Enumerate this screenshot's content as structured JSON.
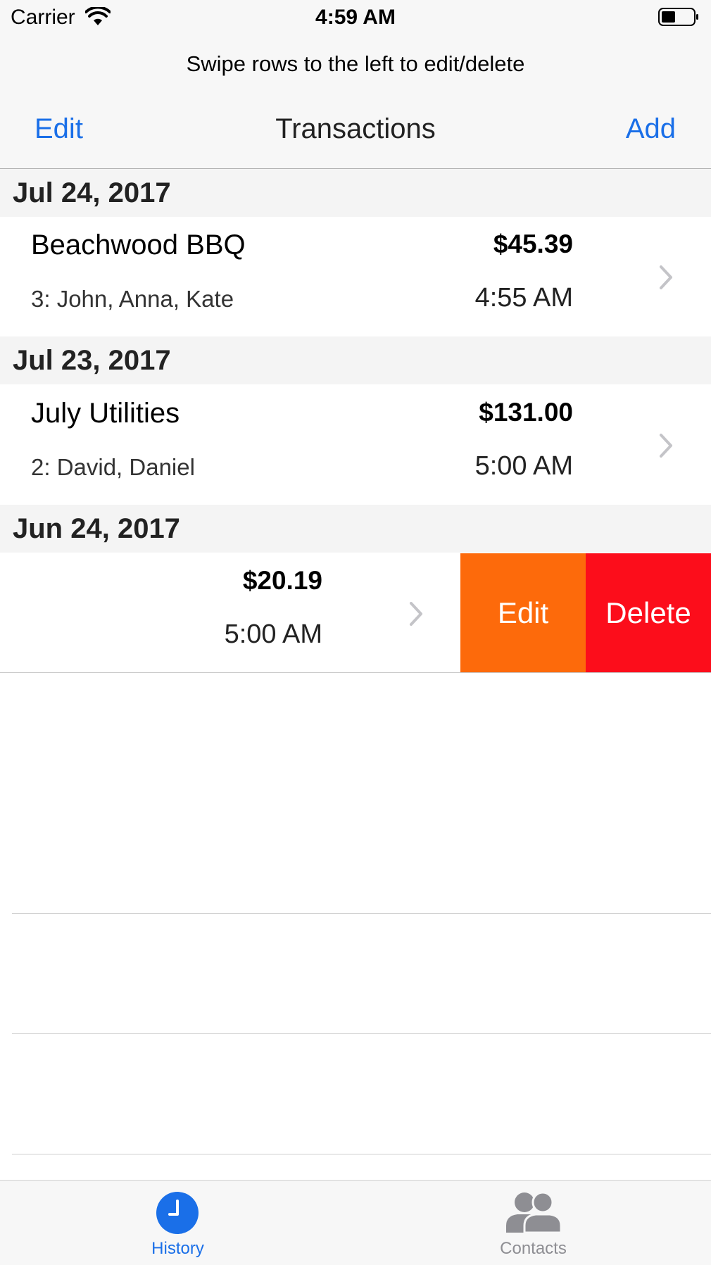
{
  "status_bar": {
    "carrier": "Carrier",
    "time": "4:59 AM"
  },
  "hint": "Swipe rows to the left to edit/delete",
  "nav": {
    "left": "Edit",
    "title": "Transactions",
    "right": "Add"
  },
  "sections": [
    {
      "date": "Jul 24, 2017",
      "rows": [
        {
          "name": "Beachwood BBQ",
          "people": "3: John, Anna, Kate",
          "amount": "$45.39",
          "time": "4:55 AM"
        }
      ]
    },
    {
      "date": "Jul 23, 2017",
      "rows": [
        {
          "name": "July Utilities",
          "people": "2: David, Daniel",
          "amount": "$131.00",
          "time": "5:00 AM"
        }
      ]
    },
    {
      "date": "Jun 24, 2017",
      "rows": [
        {
          "amount": "$20.19",
          "time": "5:00 AM"
        }
      ]
    }
  ],
  "swipe_actions": {
    "edit": "Edit",
    "delete": "Delete"
  },
  "tabs": [
    {
      "label": "History",
      "icon": "clock-icon",
      "selected": true
    },
    {
      "label": "Contacts",
      "icon": "contacts-icon",
      "selected": false
    }
  ],
  "colors": {
    "tint": "#1a6fe8",
    "edit_action": "#fd6a0b",
    "delete_action": "#fc0d1b"
  }
}
